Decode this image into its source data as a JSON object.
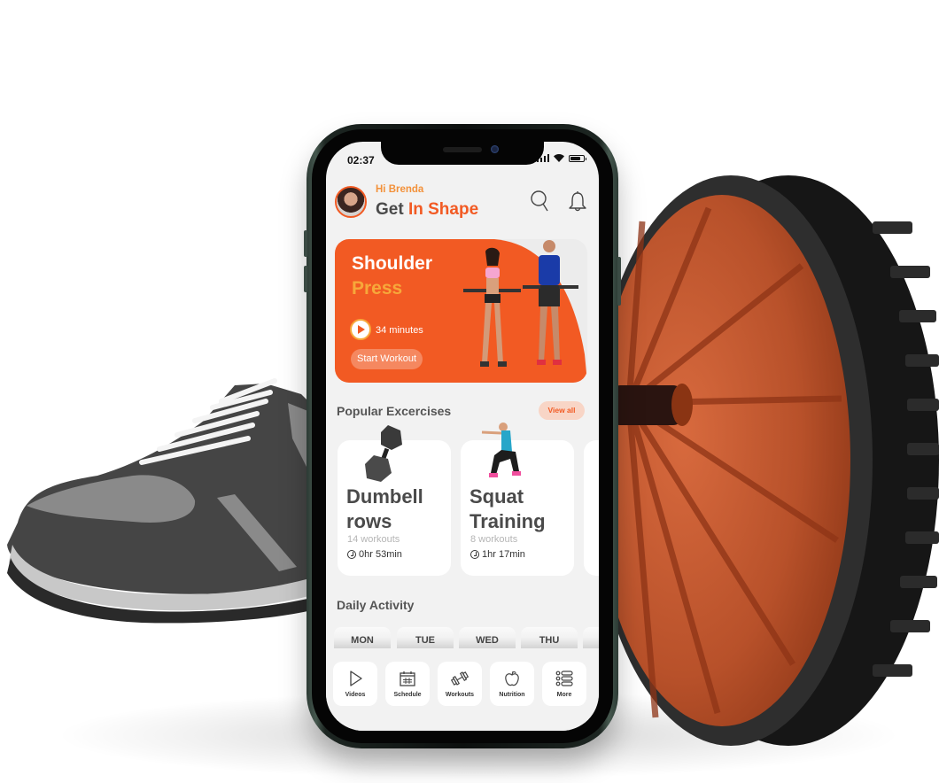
{
  "colors": {
    "accent": "#f25a23",
    "accent_light": "#f7a83a",
    "text_dark": "#4a4a4a",
    "screen_bg": "#f2f2f2"
  },
  "status_bar": {
    "time": "02:37",
    "icons": [
      "signal-icon",
      "wifi-icon",
      "battery-icon"
    ]
  },
  "header": {
    "greeting": "Hi Brenda",
    "title_prefix": "Get",
    "title_accent": "In Shape",
    "icons": [
      "search-icon",
      "bell-icon"
    ]
  },
  "hero": {
    "title_line1": "Shoulder",
    "title_line2": "Press",
    "duration": "34 minutes",
    "start_label": "Start Workout"
  },
  "popular": {
    "title": "Popular Excercises",
    "view_all_label": "View all",
    "cards": [
      {
        "title_line1": "Dumbell",
        "title_line2": "rows",
        "workouts": "14 workouts",
        "time": "0hr 53min"
      },
      {
        "title_line1": "Squat",
        "title_line2": "Training",
        "workouts": "8 workouts",
        "time": "1hr 17min"
      }
    ]
  },
  "daily": {
    "title": "Daily Activity",
    "days": [
      "MON",
      "TUE",
      "WED",
      "THU"
    ]
  },
  "bottom_nav": {
    "items": [
      {
        "label": "Videos",
        "icon": "play-icon"
      },
      {
        "label": "Schedule",
        "icon": "calendar-icon"
      },
      {
        "label": "Workouts",
        "icon": "dumbbell-icon"
      },
      {
        "label": "Nutrition",
        "icon": "apple-icon"
      },
      {
        "label": "More",
        "icon": "list-icon"
      }
    ]
  }
}
